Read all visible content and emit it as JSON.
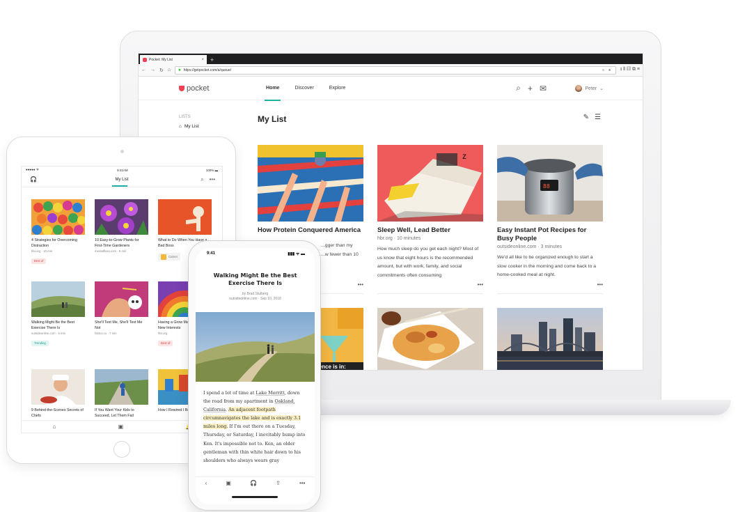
{
  "browser": {
    "tab_title": "Pocket: My List",
    "new_tab_glyph": "+",
    "close_glyph": "×",
    "url": "https://getpocket.com/a/queue/",
    "nav_glyphs": [
      "←",
      "→",
      "↻",
      "⌂"
    ],
    "right_glyphs": "≡ ★",
    "toolbar_glyphs": "⭳ ⫴ ▥ ⧉ ≡"
  },
  "pocket": {
    "logo": "pocket",
    "nav": [
      "Home",
      "Discover",
      "Explore"
    ],
    "user": "Peter",
    "user_chevron": "⌄",
    "tool_icons": [
      "⌕",
      "+",
      "✉"
    ],
    "lists_label": "LISTS",
    "my_list_item": "My List",
    "home_glyph": "⌂",
    "page_title": "My List",
    "title_icons": [
      "✎",
      "☰"
    ],
    "more_glyph": "•••",
    "cards": [
      {
        "title": "How Protein Conquered America",
        "source": "",
        "excerpt": "…gger than my\n…w fewer than 10"
      },
      {
        "title": "Sleep Well, Lead Better",
        "source": "hbr.org · 10 minutes",
        "excerpt": "How much sleep do you get each night? Most of us know that eight hours is the recommended amount, but with work, family, and social commitments often consuming"
      },
      {
        "title": "Easy Instant Pot Recipes for Busy People",
        "source": "outsideonline.com · 3 minutes",
        "excerpt": "We'd all like to be organized enough to start a slow cooker in the morning and come back to a home-cooked meal at night."
      }
    ],
    "second_row_overlay": "cience is in:"
  },
  "tablet": {
    "status_time": "9:41AM",
    "status_left": "●●●●● ᯤ",
    "status_right": "100% ▬",
    "header_title": "My List",
    "header_left_glyph": "🎧",
    "header_right_glyphs": [
      "⌕",
      "•••"
    ],
    "cards": [
      {
        "title": "4 Strategies for Overcoming Distraction",
        "source": "hbr.org · 10 min",
        "tag": "Best of"
      },
      {
        "title": "10 Easy-to-Grow Plants for First-Time Gardeners",
        "source": "mentalfloss.com · 6 min",
        "tag": ""
      },
      {
        "title": "What to Do When You Have a Bad Boss",
        "source": "",
        "tag": "Career"
      },
      {
        "title": "Walking Might Be the Best Exercise There Is",
        "source": "outsideonline.com · 5 min",
        "tag": "Trending"
      },
      {
        "title": "She'll Text Me, She'll Text Me Not",
        "source": "fastco.co · 7 min",
        "tag": ""
      },
      {
        "title": "Having a Grow Makes it Easie New Interests",
        "source": "hbr.org",
        "tag": "Best of"
      },
      {
        "title": "9 Behind-the-Scenes Secrets of Chefs",
        "source": "",
        "tag": ""
      },
      {
        "title": "If You Want Your Kids to Succeed, Let Them Fail",
        "source": "",
        "tag": ""
      },
      {
        "title": "How I Rewired I Become Fluent",
        "source": "",
        "tag": ""
      }
    ],
    "bottom_icons": [
      "⌂",
      "▣",
      "🔔"
    ]
  },
  "phone": {
    "status_time": "9:41",
    "status_right": "▮▮▮ ᯤ ▬",
    "article_title": "Walking Might Be the Best Exercise There Is",
    "byline": "by Brad Stulberg",
    "source_date": "outsideonline.com · Sep 10, 2018",
    "body": {
      "p1": "I spend a lot of time at ",
      "link1": "Lake Merritt",
      "p2": ", down the road from my apartment in ",
      "link2": "Oakland, California",
      "p3": ". ",
      "highlight": "An adjacent footpath circumnavigates the lake and is exactly 3.1 miles long.",
      "p4": " If I'm out there on a Tuesday, Thursday, or Saturday, I inevitably bump into Ken. It's impossible not to. Ken, an older gentleman with thin white hair down to his shoulders who always wears gray"
    },
    "bottom_icons": [
      "‹",
      "▣",
      "🎧",
      "⇪",
      "•••"
    ]
  }
}
